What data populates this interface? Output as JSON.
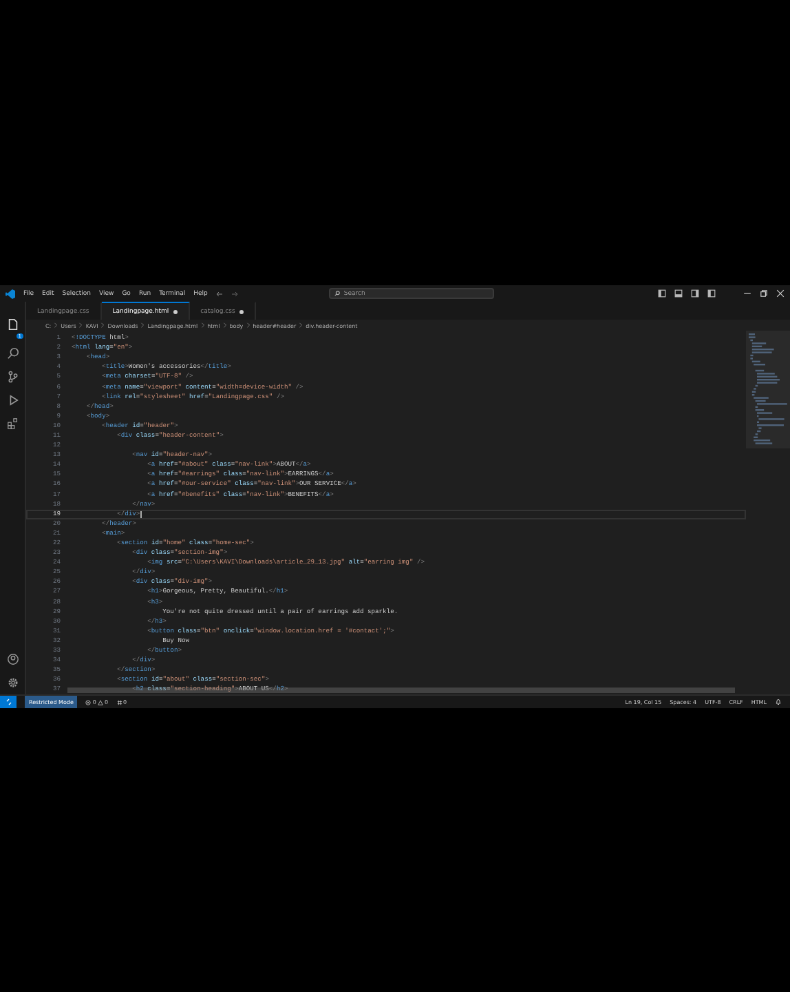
{
  "menu": [
    "File",
    "Edit",
    "Selection",
    "View",
    "Go",
    "Run",
    "Terminal",
    "Help"
  ],
  "search": {
    "placeholder": "Search"
  },
  "explorer_badge": "1",
  "tabs": [
    {
      "label": "Landingpage.css",
      "selected": false,
      "modified": false
    },
    {
      "label": "Landingpage.html",
      "selected": true,
      "modified": true
    },
    {
      "label": "catalog.css",
      "selected": false,
      "modified": true
    }
  ],
  "breadcrumb": [
    "C:",
    "Users",
    "KAVI",
    "Downloads",
    "Landingpage.html",
    "html",
    "body",
    "header#header",
    "div.header-content"
  ],
  "code_lines": [
    {
      "number": "1",
      "text": "<!DOCTYPE html>",
      "current": false
    },
    {
      "number": "2",
      "text": "<html lang=\"en\">",
      "current": false
    },
    {
      "number": "3",
      "text": "    <head>",
      "current": false
    },
    {
      "number": "4",
      "text": "        <title>Women's accessories</title>",
      "current": false
    },
    {
      "number": "5",
      "text": "        <meta charset=\"UTF-8\" />",
      "current": false
    },
    {
      "number": "6",
      "text": "        <meta name=\"viewport\" content=\"width=device-width\" />",
      "current": false
    },
    {
      "number": "7",
      "text": "        <link rel=\"stylesheet\" href=\"Landingpage.css\" />",
      "current": false
    },
    {
      "number": "8",
      "text": "    </head>",
      "current": false
    },
    {
      "number": "9",
      "text": "    <body>",
      "current": false
    },
    {
      "number": "10",
      "text": "        <header id=\"header\">",
      "current": false
    },
    {
      "number": "11",
      "text": "            <div class=\"header-content\">",
      "current": false
    },
    {
      "number": "12",
      "current": false
    },
    {
      "number": "13",
      "text": "                <nav id=\"header-nav\">",
      "current": false
    },
    {
      "number": "14",
      "text": "                    <a href=\"#about\" class=\"nav-link\">ABOUT</a>",
      "current": false
    },
    {
      "number": "15",
      "text": "                    <a href=\"#earrings\" class=\"nav-link\">EARRINGS</a>",
      "current": false
    },
    {
      "number": "16",
      "text": "                    <a href=\"#our-service\" class=\"nav-link\">OUR SERVICE</a>",
      "current": false
    },
    {
      "number": "17",
      "text": "                    <a href=\"#benefits\" class=\"nav-link\">BENEFITS</a>",
      "current": false
    },
    {
      "number": "18",
      "text": "                </nav>",
      "current": false
    },
    {
      "number": "19",
      "text": "            </div>",
      "current": true
    },
    {
      "number": "20",
      "text": "        </header>",
      "current": false
    },
    {
      "number": "21",
      "text": "        <main>",
      "current": false
    },
    {
      "number": "22",
      "text": "            <section id=\"home\" class=\"home-sec\">",
      "current": false
    },
    {
      "number": "23",
      "text": "                <div class=\"section-img\">",
      "current": false
    },
    {
      "number": "24",
      "text": "                    <img src=\"C:\\Users\\KAVI\\Downloads\\article_29_13.jpg\" alt=\"earring img\" />",
      "current": false
    },
    {
      "number": "25",
      "text": "                </div>",
      "current": false
    },
    {
      "number": "26",
      "text": "                <div class=\"div-img\">",
      "current": false
    },
    {
      "number": "27",
      "text": "                    <h1>Gorgeous, Pretty, Beautiful.</h1>",
      "current": false
    },
    {
      "number": "28",
      "text": "                    <h3>",
      "current": false
    },
    {
      "number": "29",
      "text": "                        You're not quite dressed until a pair of earrings add sparkle.",
      "current": false
    },
    {
      "number": "30",
      "text": "                    </h3>",
      "current": false
    },
    {
      "number": "31",
      "text": "                    <button class=\"btn\" onclick=\"window.location.href = '#contact';\">",
      "current": false
    },
    {
      "number": "32",
      "text": "                        Buy Now",
      "current": false
    },
    {
      "number": "33",
      "text": "                    </button>",
      "current": false
    },
    {
      "number": "34",
      "text": "                </div>",
      "current": false
    },
    {
      "number": "35",
      "text": "            </section>",
      "current": false
    },
    {
      "number": "36",
      "text": "            <section id=\"about\" class=\"section-sec\">",
      "current": false
    },
    {
      "number": "37",
      "text": "                <h2 class=\"section-heading\">ABOUT US</h2>",
      "current": false
    }
  ],
  "status_bar": {
    "mode": "Restricted Mode",
    "errors": "0",
    "warnings": "0",
    "ports": "0",
    "items": [
      "Ln 19, Col 15",
      "Spaces: 4",
      "UTF-8",
      "CRLF",
      "HTML"
    ]
  }
}
